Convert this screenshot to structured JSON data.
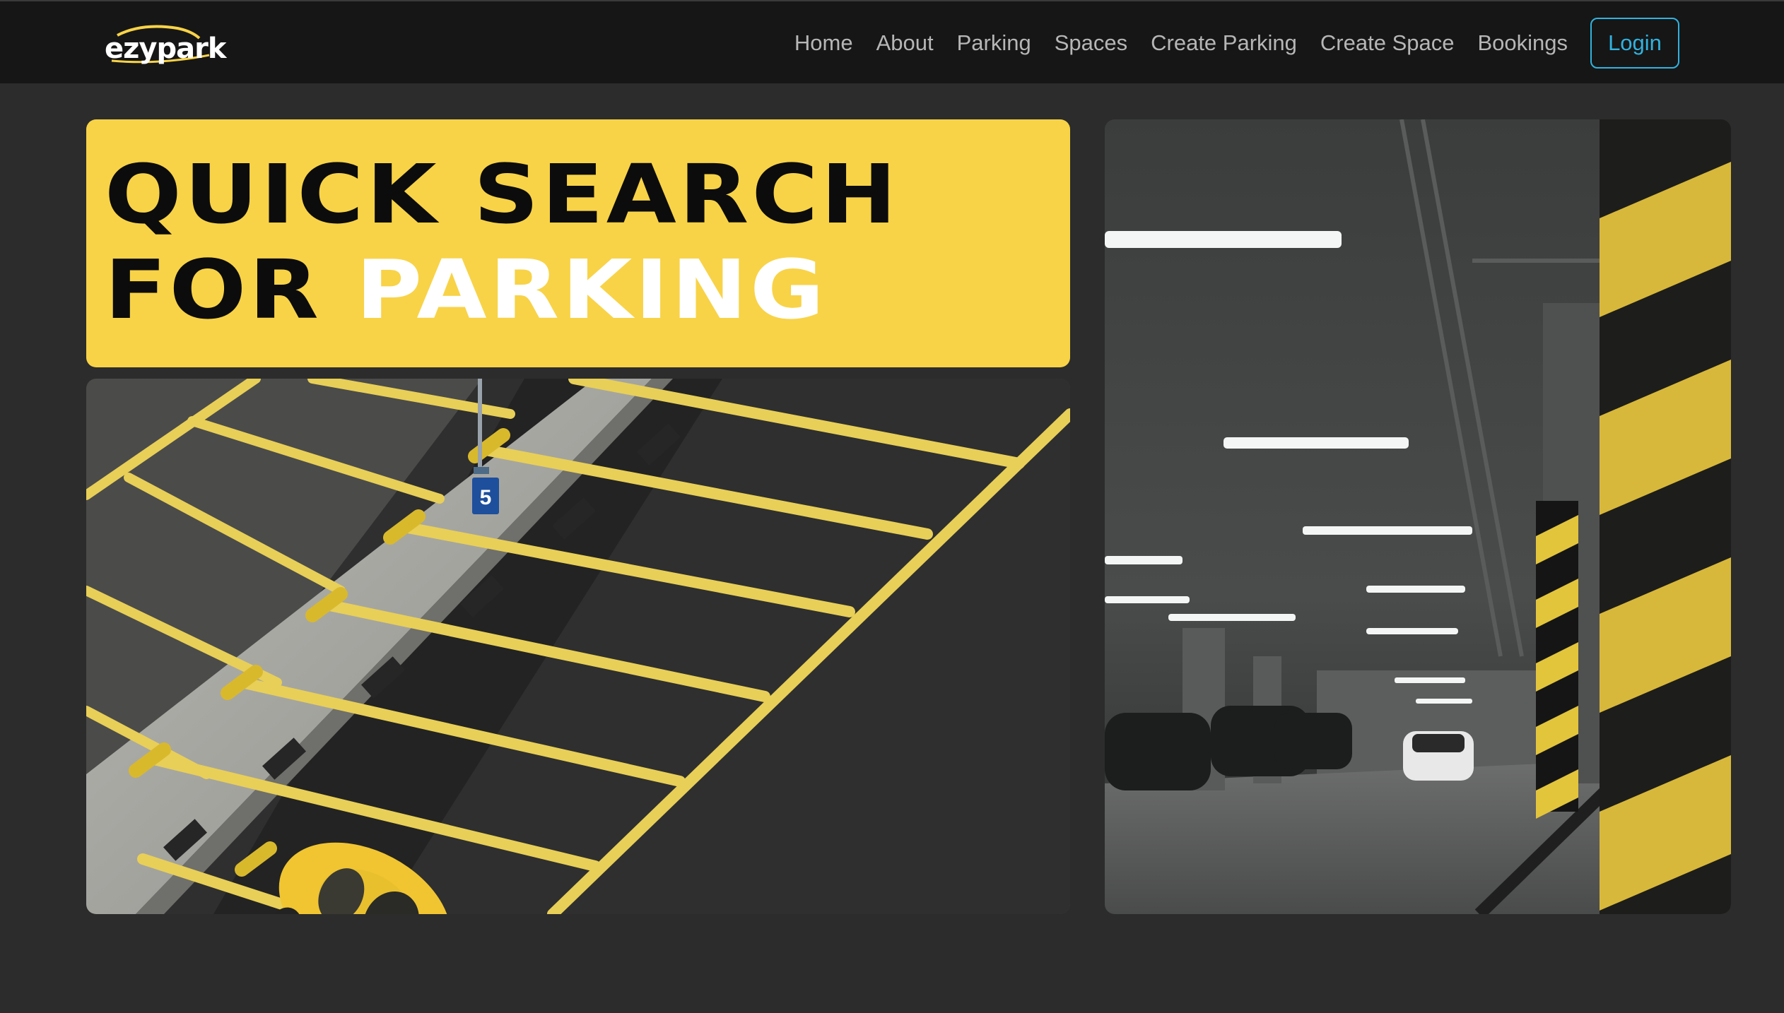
{
  "brand": {
    "name": "ezypark"
  },
  "nav": {
    "items": [
      {
        "label": "Home"
      },
      {
        "label": "About"
      },
      {
        "label": "Parking"
      },
      {
        "label": "Spaces"
      },
      {
        "label": "Create Parking"
      },
      {
        "label": "Create Space"
      },
      {
        "label": "Bookings"
      }
    ],
    "login_label": "Login"
  },
  "hero": {
    "line1": "QUICK SEARCH",
    "line2_prefix": "FOR ",
    "line2_highlight": "PARKING"
  },
  "photos": {
    "left_sign_number": "5"
  },
  "colors": {
    "accent_yellow": "#f8d347",
    "login_blue": "#31b2df",
    "navbar_bg": "#161616",
    "page_bg": "#2c2c2c"
  }
}
